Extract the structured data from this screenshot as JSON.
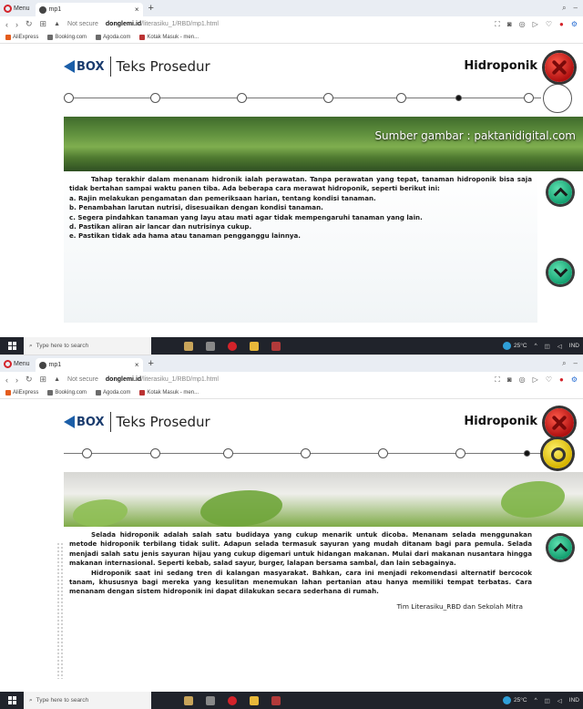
{
  "browser": {
    "menu_label": "Menu",
    "tab_title": "mp1",
    "new_tab": "+",
    "url_warning": "Not secure",
    "url_host": "donglemi.id",
    "url_path": "/literasiku_1/RBD/mp1.html",
    "bookmarks": [
      "AliExpress",
      "Booking.com",
      "Agoda.com",
      "Kotak Masuk - men..."
    ]
  },
  "header": {
    "logo_text": "BOX",
    "title": "Teks Prosedur",
    "topic": "Hidroponik"
  },
  "screen1": {
    "photo_credit": "Sumber gambar : paktanidigital.com",
    "intro": "Tahap terakhir dalam menanam hidronik ialah perawatan. Tanpa perawatan yang tepat, tanaman hidroponik bisa saja tidak bertahan sampai waktu panen tiba. Ada beberapa cara merawat hidroponik, seperti berikut ini:",
    "steps": [
      "a. Rajin melakukan pengamatan dan pemeriksaan harian, tentang kondisi tanaman.",
      "b. Penambahan larutan nutrisi, disesuaikan dengan kondisi tanaman.",
      "c. Segera pindahkan tanaman yang layu atau mati agar tidak mempengaruhi tanaman yang lain.",
      "d. Pastikan aliran air lancar dan nutrisinya cukup.",
      "e. Pastikan tidak ada hama atau tanaman pengganggu lainnya."
    ]
  },
  "screen2": {
    "para1": "Selada hidroponik adalah salah satu budidaya yang cukup menarik untuk dicoba. Menanam selada menggunakan metode hidroponik terbilang tidak sulit. Adapun selada termasuk sayuran yang mudah ditanam bagi para pemula. Selada menjadi salah satu jenis sayuran hijau yang cukup digemari untuk hidangan makanan. Mulai dari makanan nusantara hingga makanan internasional. Seperti kebab, salad sayur, burger, lalapan bersama sambal, dan lain sebagainya.",
    "para2": "Hidroponik saat ini sedang tren di kalangan masyarakat. Bahkan, cara ini menjadi rekomendasi alternatif bercocok tanam, khususnya bagi mereka yang kesulitan menemukan lahan pertanian atau hanya memiliki tempat terbatas. Cara menanam dengan sistem hidroponik ini dapat dilakukan secara sederhana di rumah.",
    "signature": "Tim Literasiku_RBD dan Sekolah Mitra"
  },
  "taskbar": {
    "search_placeholder": "Type here to search",
    "temperature": "25°C",
    "lang": "IND"
  },
  "colors": {
    "close_red": "#c0141a",
    "nav_green": "#13a070",
    "quiz_yellow": "#d6b400"
  }
}
